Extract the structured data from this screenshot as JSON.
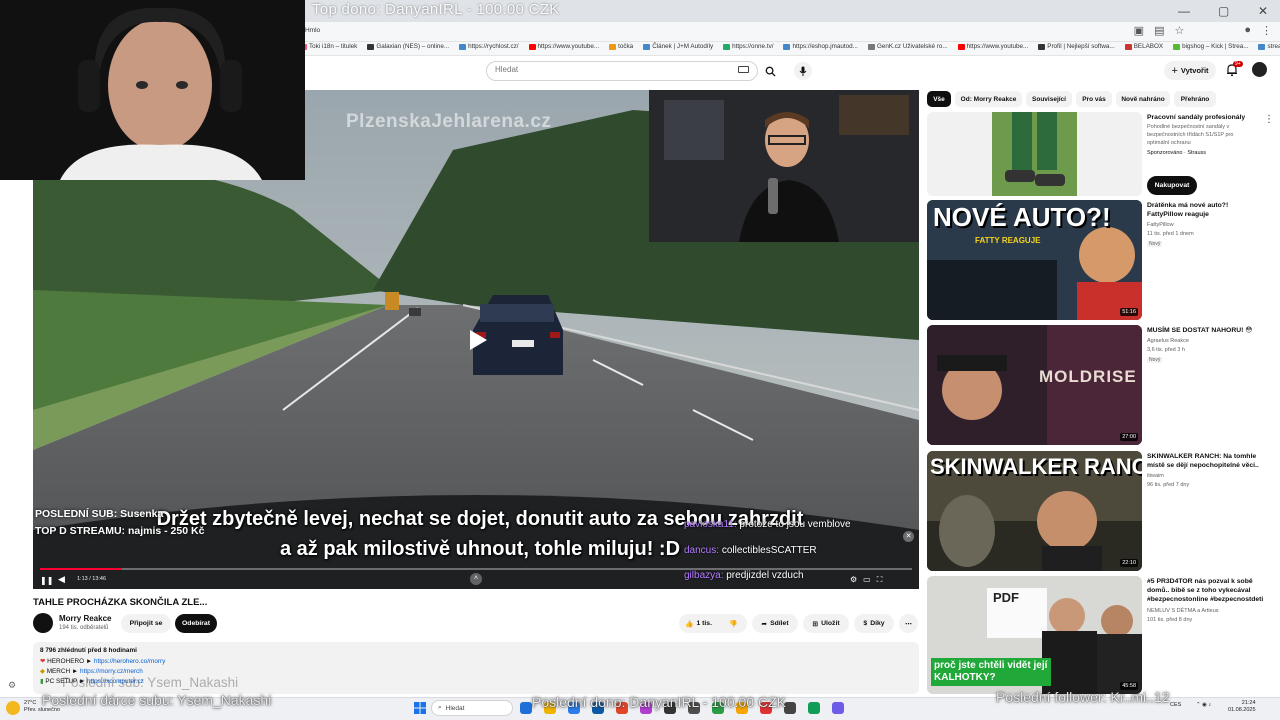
{
  "overlay": {
    "top_donation": "Top dono: DanyanIRL - 100.00 CZK",
    "last_sub_ghost": "Poslední sub: Ysem_Nakashi",
    "last_sub_donor": "Poslední dárce subu: Ysem_Nakashi",
    "last_dono": "Poslední dono: DanyanIRL - 100.00 CZK",
    "last_follower": "Poslední follower: Kr..mi..12"
  },
  "browser": {
    "tab_fragment": "Hmlo",
    "bookmarks": [
      {
        "label": "Toki i18n – titulek",
        "color": "#e57"
      },
      {
        "label": "Galaxian (NES) – online...",
        "color": "#333"
      },
      {
        "label": "https://rychlost.cz/",
        "color": "#48c"
      },
      {
        "label": "https://www.youtube...",
        "color": "#f00"
      },
      {
        "label": "točka",
        "color": "#e91"
      },
      {
        "label": "Článek | J+M Autodíly",
        "color": "#48c"
      },
      {
        "label": "https://onne.tv/",
        "color": "#2a6"
      },
      {
        "label": "https://eshop.jmautod...",
        "color": "#48c"
      },
      {
        "label": "GenK.cz Uživatelské ro...",
        "color": "#777"
      },
      {
        "label": "https://www.youtube...",
        "color": "#f00"
      },
      {
        "label": "Profil | Nejlepší softwa...",
        "color": "#333"
      },
      {
        "label": "BELABOX",
        "color": "#c33"
      },
      {
        "label": "bigshog – Kick | Strea...",
        "color": "#5b3"
      },
      {
        "label": "stream",
        "color": "#48c"
      },
      {
        "label": "gpt",
        "color": "#222"
      }
    ]
  },
  "header": {
    "search_placeholder": "Hledat",
    "create_label": "Vytvořit",
    "notif_count": "9+"
  },
  "player": {
    "watermark": "PlzenskaJehlarena.cz",
    "subtitle_line1": "Držet zbytečně levej, nechat se dojet, donutit auto za sebou zahrzdit",
    "subtitle_line2": "a až pak milostivě uhnout, tohle miluju! :D",
    "last_sub": "POSLEDNÍ SUB: Susenka",
    "top_d": "TOP D STREAMU: najmis - 250 Kč",
    "chat": [
      {
        "user": "pavloska11:",
        "text": "protože to jsou vemblove"
      },
      {
        "user": "dancus:",
        "text": "collectiblesSCATTER"
      },
      {
        "user": "gilbazya:",
        "text": "predjizdel vzduch"
      }
    ],
    "time": "1:13 / 13:46",
    "progress": 0.094
  },
  "video": {
    "title": "TAHLE PROCHÁZKA SKONČILA ZLE...",
    "channel": "Morry Reakce",
    "subs": "194 tis. odběratelů",
    "join_label": "Připojit se",
    "subscribe_label": "Odebírat",
    "like_count": "1 tis.",
    "share_label": "Sdílet",
    "save_label": "Uložit",
    "thanks_label": "Díky",
    "views": "8 796 zhlédnutí  před 8 hodinami",
    "desc_lines": [
      {
        "prefix": "HEROHERO ►",
        "link": "https://herohero.co/morry"
      },
      {
        "prefix": "MERCH ►",
        "link": "https://morry.cz/merch"
      },
      {
        "prefix": "PC SETUP ►",
        "link": "https://xcomputer.cz"
      }
    ]
  },
  "chips": [
    "Vše",
    "Od: Morry Reakce",
    "Související",
    "Pro vás",
    "Nově nahráno",
    "Přehráno"
  ],
  "recommendations": [
    {
      "title": "Pracovní sandály profesionály",
      "meta": [
        "Pohodlné bezpečnostní sandály v",
        "bezpečnostních třídách S1/S1P pro",
        "optimální ochranu"
      ],
      "sponsor": "Sponzorováno · Strauss",
      "cta": "Nakupovat",
      "duration": ""
    },
    {
      "title": "Drátěnka má nové auto?! FattyPillow reaguje",
      "meta": [
        "FattyPillow",
        "11 tis.  před 1 dnem"
      ],
      "badge": "Nový",
      "duration": "51:16",
      "thumb_text": "NOVÉ AUTO?!",
      "thumb_sub": "FATTY REAGUJE"
    },
    {
      "title": "MUSÍM SE DOSTAT NAHORU! 😳",
      "meta": [
        "Agraelus Reakce",
        "3,6 tis.  před 3 h"
      ],
      "badge": "Nový",
      "duration": "27:00",
      "thumb_text": "MOLDRISE"
    },
    {
      "title": "SKINWALKER RANCH: Na tomhle místě se dějí nepochopitelné věci..",
      "meta": [
        "itiwaim",
        "96 tis.  před 7 dny"
      ],
      "duration": "22:10",
      "thumb_text": "SKINWALKER RANCH"
    },
    {
      "title": "#5 PR3D4TOR nás pozval k sobě domů.. bibě se z toho vykecával #bezpecnostonline #bezpecnostdeti",
      "meta": [
        "NEMLUV S DĚTMA a Artieus",
        "101 tis.  před 8 dny"
      ],
      "duration": "45:58",
      "thumb_text": "proč jste chtěli vidět její KALHOTKY?"
    }
  ],
  "taskbar": {
    "weather_temp": "27°C",
    "weather_desc": "Přev. slunečno",
    "search": "Hledat",
    "lang": "CES",
    "lang2": "CZ",
    "time": "21:24",
    "date": "01.08.2025"
  },
  "colors": {
    "accent": "#ff0033",
    "link": "#065fd4",
    "chat_name": "#b57cff"
  }
}
